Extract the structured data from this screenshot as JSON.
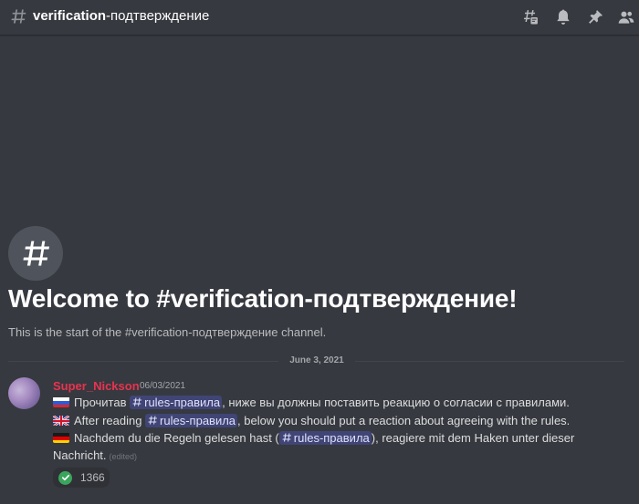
{
  "header": {
    "channel_bold": "verification",
    "channel_rest": "-подтверждение",
    "icons": [
      "threads-icon",
      "bell-icon",
      "pin-icon",
      "members-icon"
    ]
  },
  "welcome": {
    "title": "Welcome to #verification-подтверждение!",
    "subtitle": "This is the start of the #verification-подтверждение channel."
  },
  "divider": {
    "date": "June 3, 2021"
  },
  "message": {
    "author": "Super_Nickson",
    "timestamp": "06/03/2021",
    "lines": {
      "ru_before": "Прочитав ",
      "ru_mention": "rules-правила",
      "ru_after": ", ниже вы должны поставить реакцию о согласии с правилами.",
      "en_before": "After reading ",
      "en_mention": "rules-правила",
      "en_after": ", below you should put a reaction about agreeing with the rules.",
      "de_before": "Nachdem du die Regeln gelesen hast (",
      "de_mention": "rules-правила",
      "de_after": "), reagiere mit dem Haken unter dieser",
      "de_cont": "Nachricht.",
      "edited": "(edited)"
    },
    "reaction": {
      "emoji": "white-check-mark",
      "count": "1366"
    }
  },
  "colors": {
    "background": "#36393f",
    "username": "#e8334f",
    "mention_bg": "#5865f2",
    "reaction_check": "#3ba55d"
  }
}
